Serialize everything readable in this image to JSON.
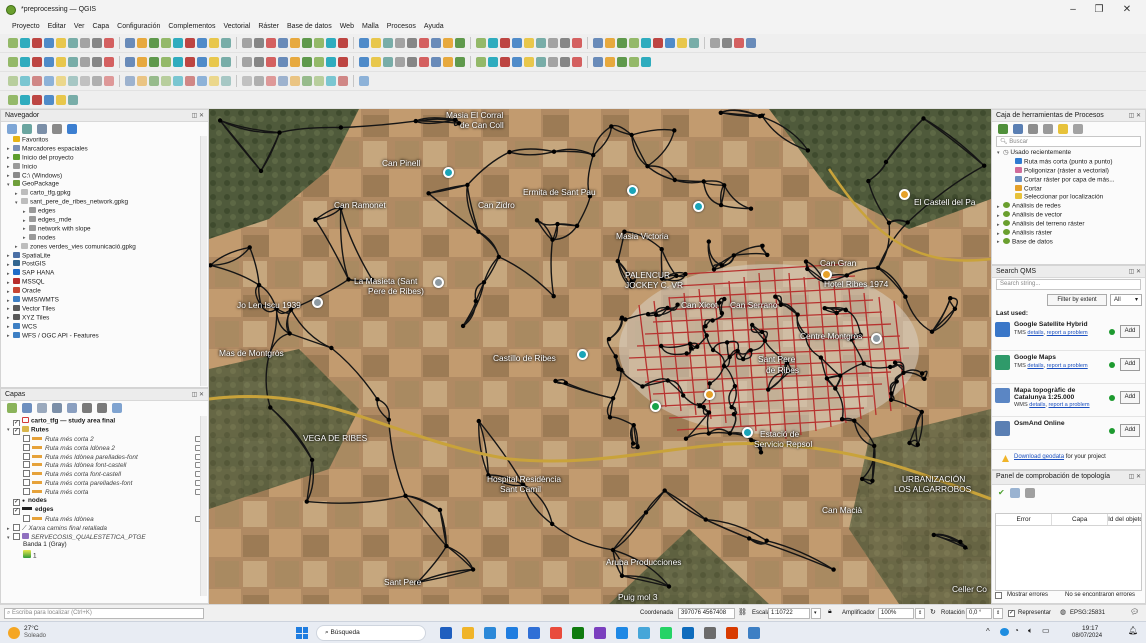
{
  "window": {
    "title": "*preprocessing — QGIS",
    "minimize": "–",
    "restore": "❐",
    "close": "✕"
  },
  "menu": [
    "Proyecto",
    "Editar",
    "Ver",
    "Capa",
    "Configuración",
    "Complementos",
    "Vectorial",
    "Ráster",
    "Base de datos",
    "Web",
    "Malla",
    "Procesos",
    "Ayuda"
  ],
  "navigator": {
    "title": "Navegador",
    "items": [
      {
        "label": "Favoritos",
        "icon": "star-icon",
        "color": "#e7b416",
        "indent": 0
      },
      {
        "label": "Marcadores espaciales",
        "icon": "bookmark-icon",
        "color": "#7a8fb5",
        "indent": 0
      },
      {
        "label": "Inicio del proyecto",
        "icon": "project-home-icon",
        "color": "#5e9e2e",
        "indent": 0
      },
      {
        "label": "Inicio",
        "icon": "home-folder-icon",
        "color": "#9a9a9a",
        "indent": 0
      },
      {
        "label": "C:\\ (Windows)",
        "icon": "drive-icon",
        "color": "#8a8a8a",
        "indent": 0
      },
      {
        "label": "GeoPackage",
        "icon": "geopackage-icon",
        "color": "#6f9f3b",
        "indent": 0
      },
      {
        "label": "carto_tfg.gpkg",
        "icon": "database-icon",
        "color": "#bdbdbd",
        "indent": 1
      },
      {
        "label": "sant_pere_de_ribes_network.gpkg",
        "icon": "database-icon",
        "color": "#bdbdbd",
        "indent": 1
      },
      {
        "label": "edges",
        "icon": "line-layer-icon",
        "color": "#9a9a9a",
        "indent": 2
      },
      {
        "label": "edges_mde",
        "icon": "line-layer-icon",
        "color": "#9a9a9a",
        "indent": 2
      },
      {
        "label": "network with slope",
        "icon": "line-layer-icon",
        "color": "#9a9a9a",
        "indent": 2
      },
      {
        "label": "nodes",
        "icon": "point-layer-icon",
        "color": "#9a9a9a",
        "indent": 2
      },
      {
        "label": "zones verdes_vies comunicació.gpkg",
        "icon": "database-icon",
        "color": "#bdbdbd",
        "indent": 1
      },
      {
        "label": "SpatiaLite",
        "icon": "spatialite-icon",
        "color": "#4a6fa5",
        "indent": 0
      },
      {
        "label": "PostGIS",
        "icon": "postgis-icon",
        "color": "#336791",
        "indent": 0
      },
      {
        "label": "SAP HANA",
        "icon": "sap-hana-icon",
        "color": "#1e6cc8",
        "indent": 0
      },
      {
        "label": "MSSQL",
        "icon": "mssql-icon",
        "color": "#b72c2c",
        "indent": 0
      },
      {
        "label": "Oracle",
        "icon": "oracle-icon",
        "color": "#c74634",
        "indent": 0
      },
      {
        "label": "WMS/WMTS",
        "icon": "globe-icon",
        "color": "#3d7fc4",
        "indent": 0
      },
      {
        "label": "Vector Tiles",
        "icon": "vector-tiles-icon",
        "color": "#5a5a5a",
        "indent": 0
      },
      {
        "label": "XYZ Tiles",
        "icon": "xyz-tiles-icon",
        "color": "#5a5a5a",
        "indent": 0
      },
      {
        "label": "WCS",
        "icon": "globe-icon",
        "color": "#3d7fc4",
        "indent": 0
      },
      {
        "label": "WFS / OGC API - Features",
        "icon": "wfs-icon",
        "color": "#3d7fc4",
        "indent": 0
      }
    ]
  },
  "layers": {
    "title": "Capas",
    "items": [
      {
        "label": "carto_tfg — study area final",
        "kind": "polygon",
        "checked": true,
        "indent": 0,
        "bold": true
      },
      {
        "label": "Rutes",
        "kind": "group",
        "checked": true,
        "indent": 0,
        "bold": true
      },
      {
        "label": "Ruta més corta 2",
        "kind": "route",
        "checked": false,
        "indent": 1
      },
      {
        "label": "Ruta más corta Idònea 2",
        "kind": "route",
        "checked": false,
        "indent": 1
      },
      {
        "label": "Ruta més Idònea parellades-font",
        "kind": "route",
        "checked": false,
        "indent": 1
      },
      {
        "label": "Ruta más Idònea font-castell",
        "kind": "route",
        "checked": false,
        "indent": 1
      },
      {
        "label": "Ruta més corta font-castell",
        "kind": "route",
        "checked": false,
        "indent": 1
      },
      {
        "label": "Ruta més corta parellades-font",
        "kind": "route",
        "checked": false,
        "indent": 1
      },
      {
        "label": "Ruta més corta",
        "kind": "route",
        "checked": false,
        "indent": 1
      },
      {
        "label": "nodes",
        "kind": "point",
        "checked": true,
        "indent": 0,
        "bold": true
      },
      {
        "label": "edges",
        "kind": "line",
        "checked": true,
        "indent": 0,
        "bold": true
      },
      {
        "label": "Ruta més Idònea",
        "kind": "route",
        "checked": false,
        "indent": 1
      },
      {
        "label": "Xarxa camins final retallada",
        "kind": "line-layer",
        "checked": false,
        "indent": 0
      },
      {
        "label": "SERVECOSIS_QUALESTETICA_PTGE",
        "kind": "raster",
        "checked": false,
        "indent": 0
      },
      {
        "label": "Banda 1 (Gray)",
        "kind": "band",
        "checked": false,
        "indent": 1
      },
      {
        "label": "1",
        "kind": "ramp",
        "checked": false,
        "indent": 1
      }
    ]
  },
  "map": {
    "labels": [
      {
        "text": "Masia El Corral",
        "l": 446,
        "t": 110
      },
      {
        "text": "de Can Coll",
        "l": 460,
        "t": 120
      },
      {
        "text": "Can Pinell",
        "l": 382,
        "t": 158
      },
      {
        "text": "Ermita de Sant Pau",
        "l": 523,
        "t": 187
      },
      {
        "text": "Can Ramonet",
        "l": 334,
        "t": 200
      },
      {
        "text": "Can Zidro",
        "l": 478,
        "t": 200
      },
      {
        "text": "Masia Victoria",
        "l": 616,
        "t": 231
      },
      {
        "text": "El Castell del Pa",
        "l": 914,
        "t": 197
      },
      {
        "text": "Can Gran",
        "l": 820,
        "t": 258
      },
      {
        "text": "La Masieta (Sant",
        "l": 354,
        "t": 276
      },
      {
        "text": "Pere de Ribes)",
        "l": 368,
        "t": 286
      },
      {
        "text": "PALENCUR",
        "l": 625,
        "t": 270
      },
      {
        "text": "JOCKEY C. VR",
        "l": 625,
        "t": 280
      },
      {
        "text": "Hotel Ribes 1974",
        "l": 824,
        "t": 279
      },
      {
        "text": "Can Xicot",
        "l": 681,
        "t": 300
      },
      {
        "text": "Can Serrano",
        "l": 730,
        "t": 300
      },
      {
        "text": "Jo Len Iscu 1939",
        "l": 237,
        "t": 300
      },
      {
        "text": "Centre Montgròs",
        "l": 800,
        "t": 331
      },
      {
        "text": "Mas de Montgròs",
        "l": 219,
        "t": 348
      },
      {
        "text": "Castillo de Ribes",
        "l": 493,
        "t": 353
      },
      {
        "text": "Sant Pere",
        "l": 758,
        "t": 354
      },
      {
        "text": "de Ribes",
        "l": 766,
        "t": 365
      },
      {
        "text": "VEGA DE RIBES",
        "l": 303,
        "t": 433
      },
      {
        "text": "Estació de",
        "l": 760,
        "t": 429
      },
      {
        "text": "Servicio Repsol",
        "l": 754,
        "t": 439
      },
      {
        "text": "Hospital Residència",
        "l": 487,
        "t": 474
      },
      {
        "text": "Sant Camil",
        "l": 500,
        "t": 484
      },
      {
        "text": "URBANIZACIÓN",
        "l": 902,
        "t": 474
      },
      {
        "text": "LOS ALGARROBOS",
        "l": 894,
        "t": 484
      },
      {
        "text": "Can Macià",
        "l": 822,
        "t": 505
      },
      {
        "text": "Aruba Producciones",
        "l": 606,
        "t": 557
      },
      {
        "text": "Puig mol 3",
        "l": 618,
        "t": 592
      },
      {
        "text": "Celler Co",
        "l": 952,
        "t": 584
      },
      {
        "text": "Sant Pere",
        "l": 384,
        "t": 577
      }
    ]
  },
  "processing": {
    "title": "Caja de herramientas de Procesos",
    "search_placeholder": "Buscar",
    "recent_header": "Usado recientemente",
    "recent": [
      "Ruta más corta (punto a punto)",
      "Poligonizar (ráster a vectorial)",
      "Cortar ráster por capa de más...",
      "Cortar",
      "Seleccionar por localización"
    ],
    "groups": [
      "Análisis de redes",
      "Análisis de vector",
      "Análisis del terreno ráster",
      "Análisis ráster",
      "Base de datos"
    ]
  },
  "qms": {
    "title": "Search QMS",
    "search_placeholder": "Search string...",
    "filter_label": "Filter by extent",
    "filter_value": "All",
    "last_used": "Last used:",
    "items": [
      {
        "name": "Google Satellite Hybrid",
        "type": "TMS",
        "add": "Add"
      },
      {
        "name": "Google Maps",
        "type": "TMS",
        "add": "Add"
      },
      {
        "name": "Mapa topogràfic de Catalunya 1:25.000",
        "type": "WMS",
        "add": "Add"
      },
      {
        "name": "OsmAnd Online",
        "type": "",
        "add": "Add"
      }
    ],
    "details": "details",
    "report": "report a problem",
    "geodata_link": "Download geodata",
    "geodata_rest": "for your project"
  },
  "topology": {
    "title": "Panel de comprobación de topología",
    "columns": [
      "Error",
      "Capa",
      "Id del objeto"
    ],
    "show_errors": "Mostrar errores",
    "no_errors": "No se encontraron errores"
  },
  "statusbar": {
    "locator_placeholder": "Escriba para localizar (Ctrl+K)",
    "coordinate_label": "Coordenada",
    "coordinate_value": "397076 4567408",
    "scale_label": "Escala",
    "scale_value": "1:10722",
    "magnifier_label": "Amplificador",
    "magnifier_value": "100%",
    "rotation_label": "Rotación",
    "rotation_value": "0,0 °",
    "render_label": "Representar",
    "crs": "EPSG:25831"
  },
  "taskbar": {
    "weather_temp": "27°C",
    "weather_desc": "Soleado",
    "search": "Búsqueda",
    "time": "19:17",
    "date": "08/07/2024"
  }
}
